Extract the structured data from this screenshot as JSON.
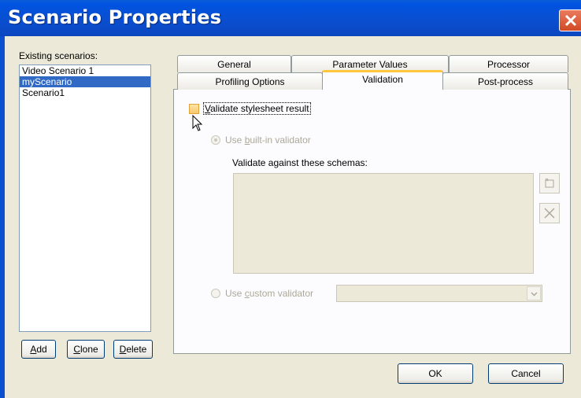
{
  "window": {
    "title": "Scenario Properties"
  },
  "scenarios": {
    "label": "Existing scenarios:",
    "items": [
      {
        "label": "Video Scenario 1",
        "selected": false
      },
      {
        "label": "myScenario",
        "selected": true
      },
      {
        "label": "Scenario1",
        "selected": false
      }
    ],
    "buttons": {
      "add": {
        "label": "Add",
        "mnemonic": "A",
        "rest": "dd"
      },
      "clone": {
        "label": "Clone",
        "mnemonic": "C",
        "rest": "lone"
      },
      "delete": {
        "label": "Delete",
        "mnemonic": "D",
        "rest": "elete"
      }
    }
  },
  "tabs": {
    "row1": [
      "General",
      "Parameter Values",
      "Processor"
    ],
    "row2": [
      "Profiling Options",
      "Validation",
      "Post-process"
    ],
    "active": "Validation"
  },
  "validation": {
    "validate_result": {
      "mnemonic": "V",
      "rest": "alidate stylesheet result",
      "checked": false
    },
    "builtin": {
      "pre": "Use ",
      "mnemonic": "b",
      "rest": "uilt-in validator",
      "selected": true,
      "enabled": false
    },
    "schemas_label": "Validate against these schemas:",
    "custom": {
      "pre": "Use ",
      "mnemonic": "c",
      "rest": "ustom validator",
      "selected": false,
      "enabled": false
    },
    "custom_value": ""
  },
  "footer": {
    "ok_label": "OK",
    "cancel_label": "Cancel"
  },
  "icons": {
    "close": "close-icon",
    "add_schema": "add-schema-icon",
    "remove_schema": "remove-schema-icon",
    "dropdown": "chevron-down-icon",
    "cursor": "mouse-pointer-icon"
  },
  "colors": {
    "titlebar": "#0a4fd0",
    "selection": "#316ac5",
    "active_tab_accent": "#ffc83c",
    "close": "#d24a25"
  }
}
